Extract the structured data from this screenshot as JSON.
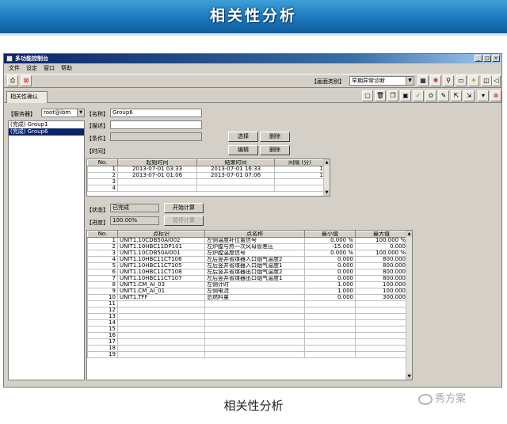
{
  "banner": {
    "title": "相关性分析"
  },
  "window": {
    "title": "多功能控制台"
  },
  "menu": [
    "文件",
    "设定",
    "窗口",
    "帮助"
  ],
  "toolbar": {
    "category_label": "【画面类别】",
    "category_value": "早期异常诊断"
  },
  "tab": {
    "label": "相关性确认"
  },
  "server": {
    "label": "【服务器】",
    "value": "root@ibm"
  },
  "groups": [
    {
      "label": "(完成) Group1",
      "selected": false
    },
    {
      "label": "(完成) Group6",
      "selected": true
    }
  ],
  "form": {
    "name_label": "【名称】",
    "name_value": "Group6",
    "desc_label": "【描述】",
    "desc_value": "",
    "cond_label": "【条件】",
    "cond_value": "",
    "time_label": "【时间】",
    "status_label": "【状态】",
    "status_value": "已完成",
    "progress_label": "【进度】",
    "progress_value": "100.00%"
  },
  "buttons": {
    "select": "选择",
    "delete1": "删除",
    "edit": "编辑",
    "delete2": "删除",
    "start_calc": "开始计算",
    "stop_calc": "暂停计算"
  },
  "time_table": {
    "headers": [
      "No.",
      "起始时间",
      "结束时间",
      "间隔 (分)"
    ],
    "rows": [
      [
        "1",
        "2013-07-01 03:33",
        "2013-07-01 16:33",
        "1"
      ],
      [
        "2",
        "2013-07-01 01:06",
        "2013-07-01 07:06",
        "1"
      ],
      [
        "3",
        "",
        "",
        ""
      ],
      [
        "4",
        "",
        "",
        ""
      ]
    ]
  },
  "point_table": {
    "headers": [
      "No.",
      "点标识",
      "点名称",
      "最小值",
      "最大值"
    ],
    "rows": [
      [
        "1",
        "UNIT1.10CDB50AI002",
        "左侧温度补位置信号",
        "0.000 %",
        "100.000 %"
      ],
      [
        "2",
        "UNIT1.10HBC11DP101",
        "左炉膛与热一次风母管差压",
        "-15.000",
        "0.000"
      ],
      [
        "3",
        "UNIT1.10CDB50AI001",
        "左炉膛温度信号",
        "0.000 %",
        "100.000 %"
      ],
      [
        "4",
        "UNIT1.10HBC11CT106",
        "左后竖井省煤器入口烟气温度2",
        "0.000",
        "800.000"
      ],
      [
        "5",
        "UNIT1.10HBC11CT105",
        "左后竖井省煤器入口烟气温度1",
        "0.000",
        "800.000"
      ],
      [
        "6",
        "UNIT1.10HBC11CT108",
        "左后竖井省煤器出口烟气温度2",
        "0.000",
        "800.000"
      ],
      [
        "7",
        "UNIT1.10HBC11CT107",
        "左后竖井省煤器出口烟气温度1",
        "0.000",
        "800.000"
      ],
      [
        "8",
        "UNIT1.CM_AI_03",
        "左侧计时",
        "1.000",
        "100.000"
      ],
      [
        "9",
        "UNIT1.CM_AI_01",
        "左侧电流",
        "1.000",
        "100.000"
      ],
      [
        "10",
        "UNIT1.TFF",
        "总燃料量",
        "0.000",
        "300.000"
      ],
      [
        "11",
        "",
        "",
        "",
        ""
      ],
      [
        "12",
        "",
        "",
        "",
        ""
      ],
      [
        "13",
        "",
        "",
        "",
        ""
      ],
      [
        "14",
        "",
        "",
        "",
        ""
      ],
      [
        "15",
        "",
        "",
        "",
        ""
      ],
      [
        "16",
        "",
        "",
        "",
        ""
      ],
      [
        "17",
        "",
        "",
        "",
        ""
      ],
      [
        "18",
        "",
        "",
        "",
        ""
      ],
      [
        "19",
        "",
        "",
        "",
        ""
      ]
    ]
  },
  "caption": "相关性分析",
  "watermark": "秀方案",
  "icons": [
    "print-icon",
    "stop-icon",
    "new-icon",
    "delete-icon",
    "copy-icon",
    "save-icon",
    "check-icon",
    "settings-icon",
    "edit-icon",
    "close-icon",
    "mute-icon"
  ]
}
